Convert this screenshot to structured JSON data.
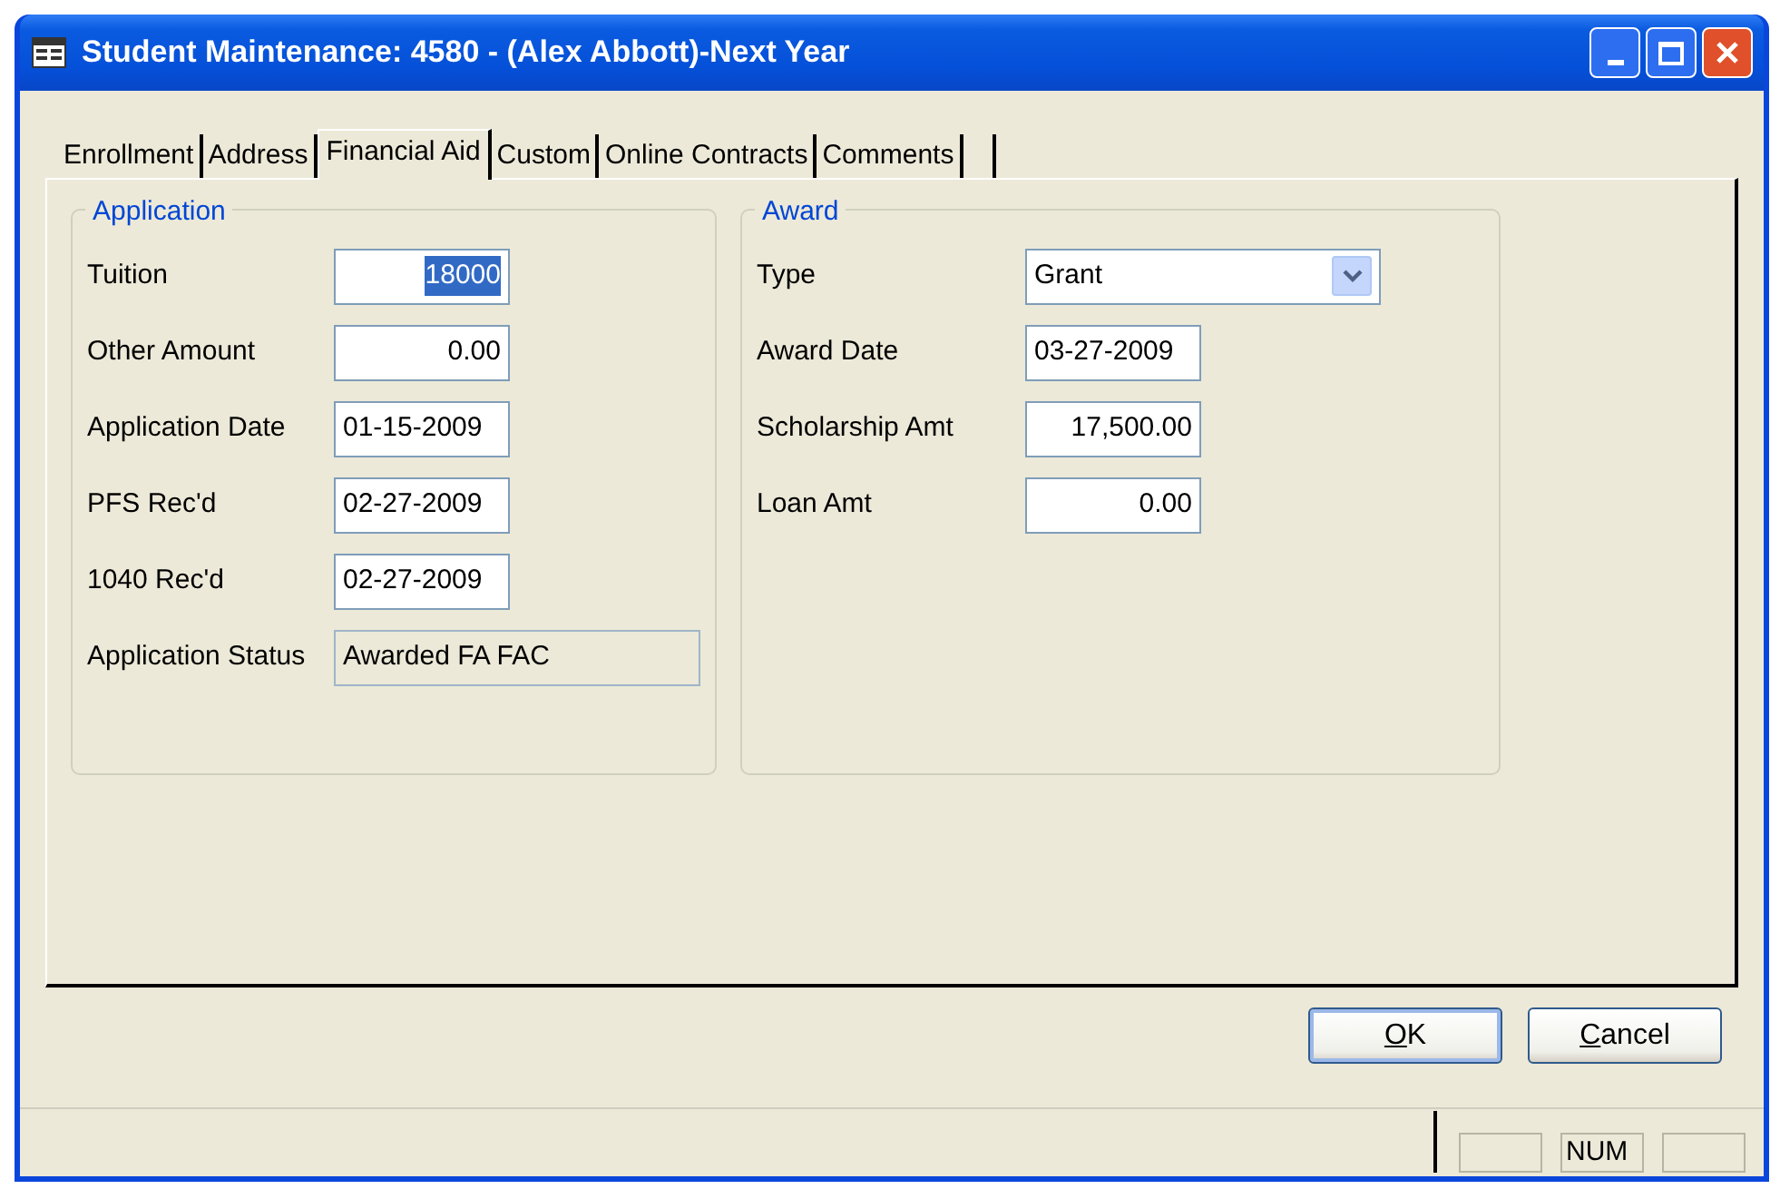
{
  "window": {
    "title": "Student Maintenance: 4580 - (Alex Abbott)-Next Year"
  },
  "tabs": [
    {
      "label": "Enrollment",
      "selected": false
    },
    {
      "label": "Address",
      "selected": false
    },
    {
      "label": "Financial Aid",
      "selected": true
    },
    {
      "label": "Custom",
      "selected": false
    },
    {
      "label": "Online Contracts",
      "selected": false
    },
    {
      "label": "Comments",
      "selected": false
    }
  ],
  "groups": [
    {
      "title": "Application",
      "fields": [
        {
          "label": "Tuition",
          "kind": "amount",
          "value": "18000",
          "highlighted": true,
          "readonly": false
        },
        {
          "label": "Other Amount",
          "kind": "amount",
          "value": "0.00",
          "highlighted": false,
          "readonly": false
        },
        {
          "label": "Application Date",
          "kind": "date",
          "value": "01-15-2009",
          "highlighted": false,
          "readonly": false
        },
        {
          "label": "PFS Rec'd",
          "kind": "date",
          "value": "02-27-2009",
          "highlighted": false,
          "readonly": false
        },
        {
          "label": "1040 Rec'd",
          "kind": "date",
          "value": "02-27-2009",
          "highlighted": false,
          "readonly": false
        },
        {
          "label": "Application Status",
          "kind": "wide",
          "value": "Awarded FA FAC",
          "highlighted": false,
          "readonly": true
        }
      ]
    },
    {
      "title": "Award",
      "fields": [
        {
          "label": "Type",
          "kind": "dropdown",
          "value": "Grant",
          "highlighted": false,
          "readonly": false
        },
        {
          "label": "Award Date",
          "kind": "date",
          "value": "03-27-2009",
          "highlighted": false,
          "readonly": false
        },
        {
          "label": "Scholarship Amt",
          "kind": "amount",
          "value": "17,500.00",
          "highlighted": false,
          "readonly": false
        },
        {
          "label": "Loan Amt",
          "kind": "amount",
          "value": "0.00",
          "highlighted": false,
          "readonly": false
        }
      ]
    }
  ],
  "buttons": [
    {
      "label": "OK",
      "underline_first": true,
      "default": true
    },
    {
      "label": "Cancel",
      "underline_first": true,
      "default": false
    }
  ],
  "status_bar": {
    "indicator": "NUM"
  }
}
